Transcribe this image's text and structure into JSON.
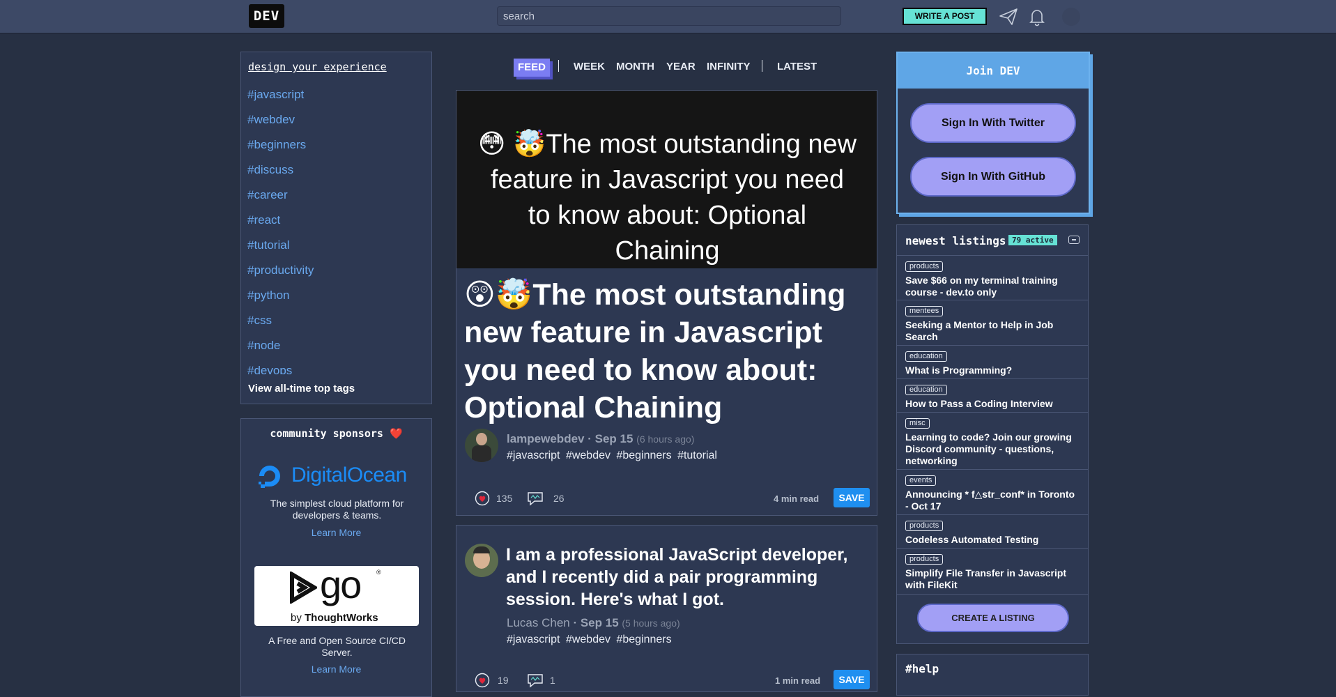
{
  "topbar": {
    "logo": "DEV",
    "search_placeholder": "search",
    "write_post": "WRITE A POST",
    "icons": [
      "paper-plane-icon",
      "bell-icon",
      "avatar"
    ]
  },
  "sidebar": {
    "heading": "design your experience",
    "tags": [
      "#javascript",
      "#webdev",
      "#beginners",
      "#discuss",
      "#career",
      "#react",
      "#tutorial",
      "#productivity",
      "#python",
      "#css",
      "#node",
      "#devops"
    ],
    "all_tags_link": "View all-time top tags"
  },
  "sponsors": {
    "heading": "community sponsors",
    "heart": "❤️",
    "items": [
      {
        "name": "DigitalOcean",
        "description": "The simplest cloud platform for developers & teams.",
        "link": "Learn More"
      },
      {
        "name": "go",
        "byline_prefix": "by ",
        "byline_brand": "ThoughtWorks",
        "mark": "®",
        "description": "A Free and Open Source CI/CD Server.",
        "link": "Learn More"
      }
    ]
  },
  "feed_nav": {
    "items": [
      "FEED",
      "WEEK",
      "MONTH",
      "YEAR",
      "INFINITY",
      "LATEST"
    ],
    "active": "FEED"
  },
  "articles": [
    {
      "cover_text": "😳 🤯The most outstanding new feature in Javascript you need to know about: Optional Chaining",
      "title": "😲🤯The most outstanding new feature in Javascript you need to know about: Optional Chaining",
      "author": "lampewebdev",
      "date": "Sep 15",
      "relative": "(6 hours ago)",
      "tags": [
        "#javascript",
        "#webdev",
        "#beginners",
        "#tutorial"
      ],
      "reactions": "135",
      "comments": "26",
      "read_time": "4 min read",
      "save": "SAVE"
    },
    {
      "title": "I am a professional JavaScript developer, and I recently did a pair programming session. Here's what I got.",
      "author": "Lucas Chen",
      "date": "Sep 15",
      "relative": "(5 hours ago)",
      "tags": [
        "#javascript",
        "#webdev",
        "#beginners"
      ],
      "reactions": "19",
      "comments": "1",
      "read_time": "1 min read",
      "save": "SAVE"
    }
  ],
  "join": {
    "heading": "Join DEV",
    "twitter": "Sign In With Twitter",
    "github": "Sign In With GitHub"
  },
  "listings": {
    "heading": "newest listings",
    "active_badge": "79 active",
    "items": [
      {
        "category": "products",
        "title": "Save $66 on my terminal training course - dev.to only"
      },
      {
        "category": "mentees",
        "title": "Seeking a Mentor to Help in Job Search"
      },
      {
        "category": "education",
        "title": "What is Programming?"
      },
      {
        "category": "education",
        "title": "How to Pass a Coding Interview"
      },
      {
        "category": "misc",
        "title": "Learning to code? Join our growing Discord community - questions, networking"
      },
      {
        "category": "events",
        "title": "Announcing * f△str_conf* in Toronto - Oct 17"
      },
      {
        "category": "products",
        "title": "Codeless Automated Testing"
      },
      {
        "category": "products",
        "title": "Simplify File Transfer in Javascript with FileKit"
      }
    ],
    "create_button": "CREATE A LISTING"
  },
  "help": {
    "heading": "#help"
  },
  "colors": {
    "background": "#273043",
    "card": "#2d3852",
    "accent_teal": "#66e2d5",
    "accent_purple": "#a29ff5",
    "link_blue": "#6aa9ef",
    "save_blue": "#1f8ff0"
  }
}
